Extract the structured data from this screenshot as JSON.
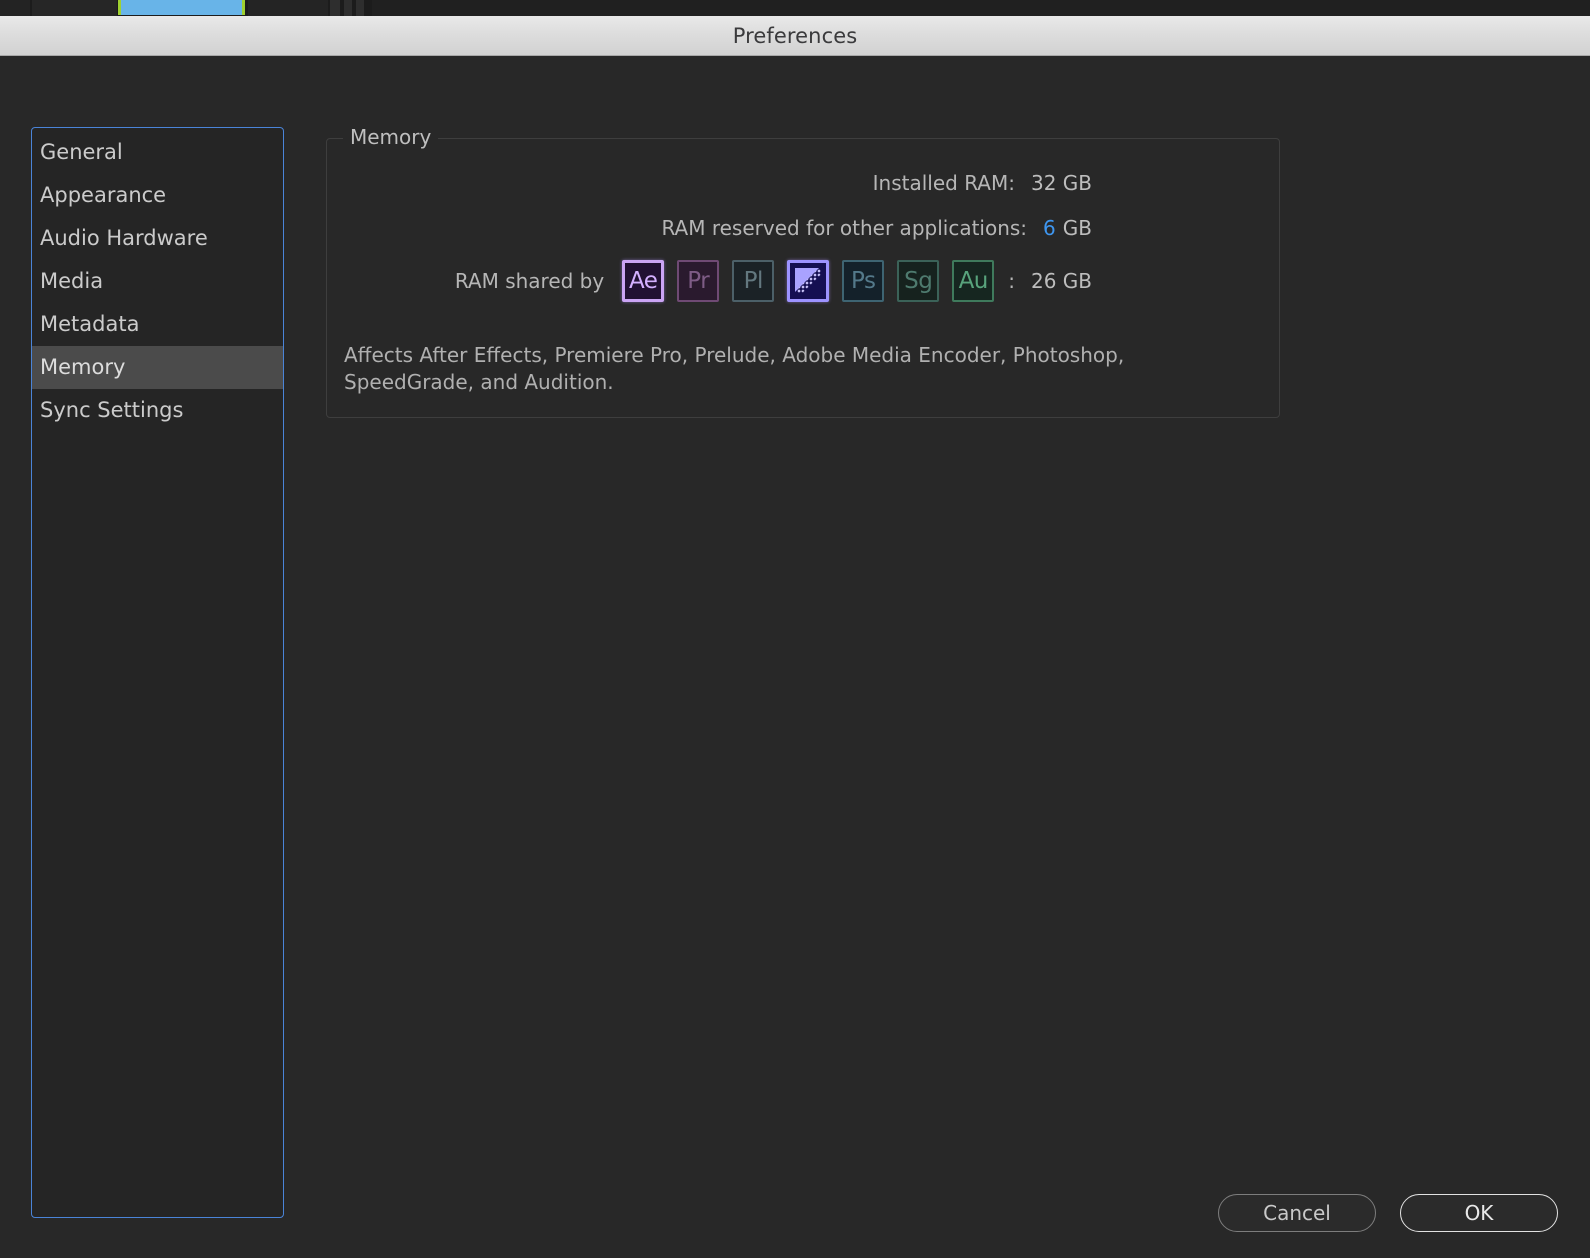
{
  "background": {
    "clip_label": "timeline-clip"
  },
  "window": {
    "title": "Preferences"
  },
  "sidebar": {
    "items": [
      {
        "label": "General",
        "selected": false
      },
      {
        "label": "Appearance",
        "selected": false
      },
      {
        "label": "Audio Hardware",
        "selected": false
      },
      {
        "label": "Media",
        "selected": false
      },
      {
        "label": "Metadata",
        "selected": false
      },
      {
        "label": "Memory",
        "selected": true
      },
      {
        "label": "Sync Settings",
        "selected": false
      }
    ]
  },
  "memory_panel": {
    "legend": "Memory",
    "installed_ram": {
      "label": "Installed RAM:",
      "value": "32 GB"
    },
    "reserved_ram": {
      "label": "RAM reserved for other applications:",
      "value": "6",
      "unit": "GB"
    },
    "shared_ram": {
      "label": "RAM shared by",
      "separator": ":",
      "value": "26 GB",
      "apps": [
        {
          "code": "Ae",
          "name": "after-effects",
          "selected": true
        },
        {
          "code": "Pr",
          "name": "premiere-pro",
          "selected": false
        },
        {
          "code": "Pl",
          "name": "prelude",
          "selected": false
        },
        {
          "code": "",
          "name": "adobe-media-encoder",
          "selected": true
        },
        {
          "code": "Ps",
          "name": "photoshop",
          "selected": false
        },
        {
          "code": "Sg",
          "name": "speedgrade",
          "selected": false
        },
        {
          "code": "Au",
          "name": "audition",
          "selected": false
        }
      ]
    },
    "description": "Affects After Effects, Premiere Pro, Prelude, Adobe Media Encoder, Photoshop, SpeedGrade, and Audition."
  },
  "footer": {
    "cancel_label": "Cancel",
    "ok_label": "OK"
  },
  "colors": {
    "accent_blue": "#3e96f0",
    "focus_border": "#4a84d8",
    "selection_bg": "#4b4b4b",
    "dialog_bg": "#282828",
    "titlebar_text": "#3a3a3c"
  }
}
